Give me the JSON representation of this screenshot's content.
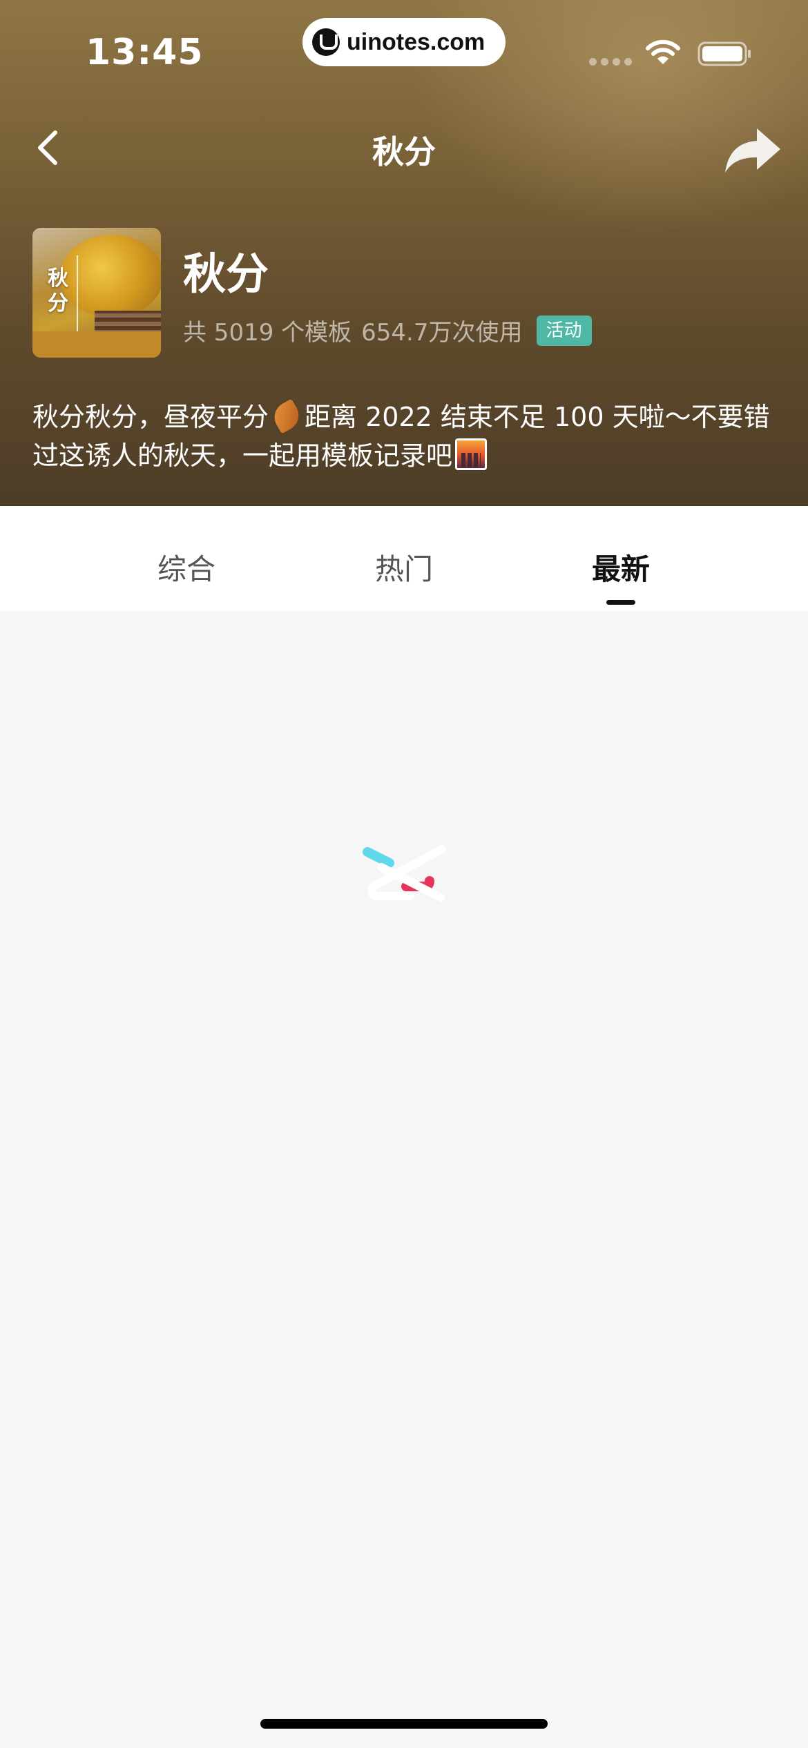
{
  "status_bar": {
    "time": "13:45",
    "url": "uinotes.com"
  },
  "nav": {
    "title": "秋分"
  },
  "topic": {
    "cover_text": "秋分",
    "title": "秋分",
    "template_count": "共 5019 个模板",
    "usage_count": "654.7万次使用",
    "badge": "活动",
    "badge_color": "#4fb8a5",
    "description_part1": "秋分秋分，昼夜平分",
    "description_part2": "距离 2022 结束不足 100 天啦～不要错过这诱人的秋天，一起用模板记录吧"
  },
  "tabs": [
    {
      "label": "综合",
      "active": false
    },
    {
      "label": "热门",
      "active": false
    },
    {
      "label": "最新",
      "active": true
    }
  ],
  "icons": {
    "back": "chevron-left-icon",
    "share": "share-arrow-icon",
    "loader": "capcut-logo-icon",
    "leaf_emoji": "fallen-leaf-emoji",
    "city_emoji": "cityscape-sunset-emoji"
  },
  "colors": {
    "header_bg": "#7a6238",
    "page_bg": "#f6f6f6",
    "loader_cyan": "#5fd8ec",
    "loader_red": "#e8345a"
  }
}
